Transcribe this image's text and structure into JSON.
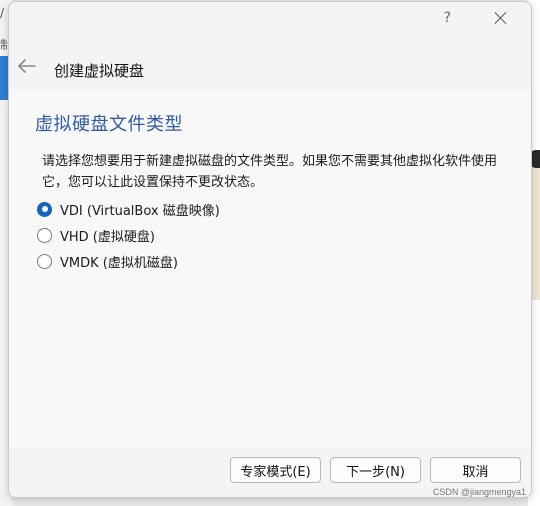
{
  "background": {
    "left_label_top": "/",
    "left_label_mid": "制",
    "accent_blue": "#2f7fd1"
  },
  "dialog": {
    "help_label": "?",
    "close_icon": "close-icon",
    "back_icon": "back-arrow-icon",
    "wizard_title": "创建虚拟硬盘"
  },
  "page": {
    "title": "虚拟硬盘文件类型",
    "description": "请选择您想要用于新建虚拟磁盘的文件类型。如果您不需要其他虚拟化软件使用它，您可以让此设置保持不更改状态。",
    "options": [
      {
        "label": "VDI (VirtualBox 磁盘映像)",
        "checked": true
      },
      {
        "label": "VHD (虚拟硬盘)",
        "checked": false
      },
      {
        "label": "VMDK (虚拟机磁盘)",
        "checked": false
      }
    ]
  },
  "footer": {
    "expert_label": "专家模式(E)",
    "next_label": "下一步(N)",
    "cancel_label": "取消"
  },
  "watermark": "CSDN @jiangmengya1",
  "colors": {
    "title_blue": "#2f5aa8",
    "radio_selected": "#1565c0"
  }
}
